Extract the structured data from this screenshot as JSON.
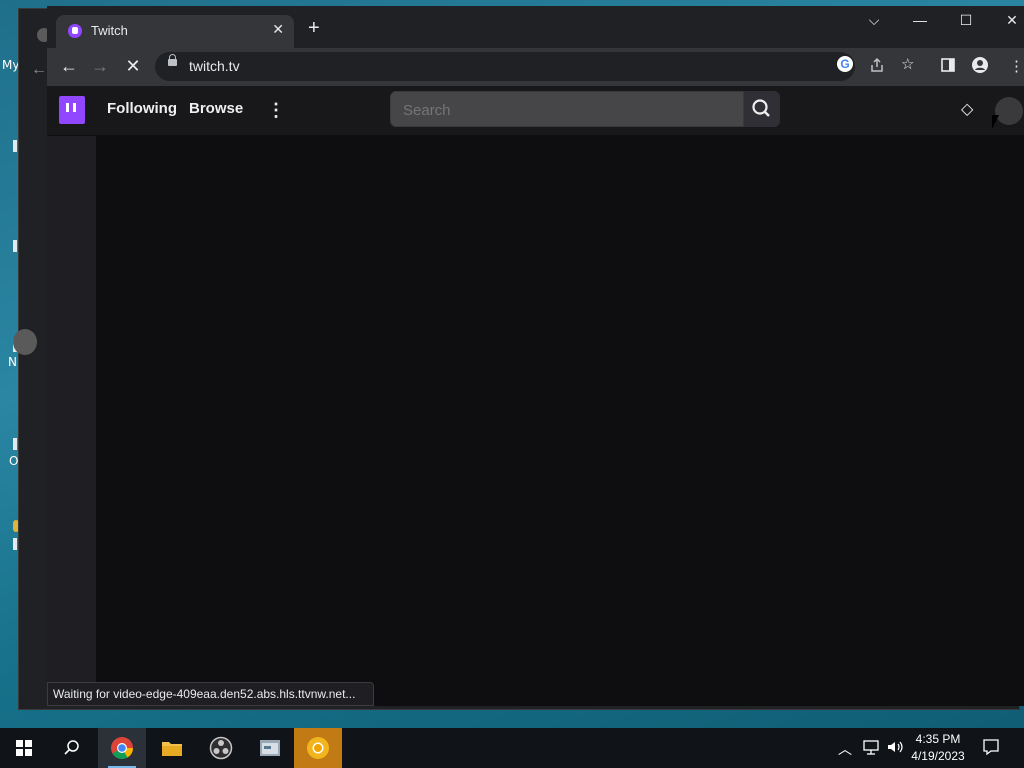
{
  "desktop": {
    "labels": [
      "My",
      "N",
      "O"
    ]
  },
  "browser": {
    "tab_title": "Twitch",
    "tab_close_glyph": "✕",
    "new_tab_glyph": "+",
    "window_controls": {
      "dropdown": "⌵",
      "minimize": "—",
      "maximize": "☐",
      "close": "✕"
    },
    "nav": {
      "back": "←",
      "forward": "→",
      "stop": "✕"
    },
    "url": "twitch.tv",
    "status_text": "Waiting for video-edge-409eaa.den52.abs.hls.ttvnw.net..."
  },
  "twitch": {
    "nav": {
      "following": "Following",
      "browse": "Browse",
      "more": "⋮"
    },
    "search_placeholder": "Search",
    "prime_glyph": "◇"
  },
  "taskbar": {
    "time": "4:35 PM",
    "date": "4/19/2023",
    "items": [
      "start",
      "search",
      "chrome",
      "file-explorer",
      "obs",
      "app",
      "chrome-canary"
    ]
  },
  "colors": {
    "twitch_purple": "#9147ff",
    "browser_bg": "#202124",
    "toolbar_bg": "#35363a",
    "twitch_bg": "#0e0e10"
  }
}
